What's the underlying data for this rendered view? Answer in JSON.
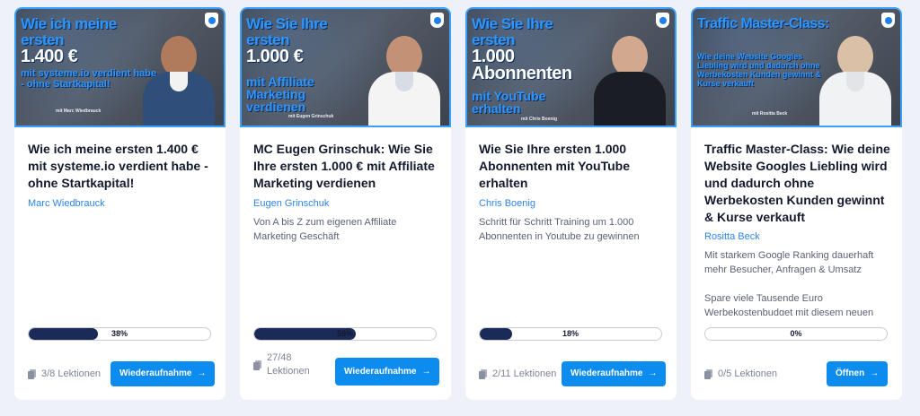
{
  "courses": [
    {
      "thumb_lines": [
        "Wie ich meine ersten",
        "1.400 €"
      ],
      "thumb_sub": "mit systeme.io verdient habe\n- ohne Startkapital!",
      "thumb_byline": "mit Marc Wiedbrauck",
      "title": "Wie ich meine ersten 1.400 € mit systeme.io verdient habe - ohne Startkapital!",
      "author": "Marc Wiedbrauck",
      "description": "",
      "progress_label": "38%",
      "progress": 0.38,
      "lessons": "3/8 Lektionen",
      "button": "Wiederaufnahme"
    },
    {
      "thumb_lines": [
        "Wie Sie Ihre",
        "ersten",
        "1.000 €"
      ],
      "thumb_sub": "mit Affiliate\nMarketing\nverdienen",
      "thumb_byline": "mit Eugen Grinschuk",
      "title": "MC Eugen Grinschuk: Wie Sie Ihre ersten 1.000 € mit Affiliate Marketing verdienen",
      "author": "Eugen Grinschuk",
      "description": "Von A bis Z zum eigenen Affiliate Marketing Geschäft",
      "progress_label": "56%",
      "progress": 0.56,
      "lessons": "27/48\nLektionen",
      "button": "Wiederaufnahme"
    },
    {
      "thumb_lines": [
        "Wie Sie Ihre",
        "ersten",
        "1.000",
        "Abonnenten"
      ],
      "thumb_sub": "mit YouTube\nerhalten",
      "thumb_byline": "mit Chris Boenig",
      "title": "Wie Sie Ihre ersten 1.000 Abonnenten mit YouTube erhalten",
      "author": "Chris Boenig",
      "description": "Schritt für Schritt Training um 1.000 Abonnenten in Youtube zu gewinnen",
      "progress_label": "18%",
      "progress": 0.18,
      "lessons": "2/11 Lektionen",
      "button": "Wiederaufnahme"
    },
    {
      "thumb_lines": [
        "Traffic Master-Class:"
      ],
      "thumb_sub": "Wie deine Website Googles\nLiebling wird und dadurch ohne\nWerbekosten Kunden gewinnt &\nKurse verkauft",
      "thumb_byline": "mit Rositta Beck",
      "title": "Traffic Master-Class: Wie deine Website Googles Liebling wird und dadurch ohne Werbekosten Kunden gewinnt & Kurse verkauft",
      "author": "Rositta Beck",
      "description": "Mit starkem Google Ranking dauerhaft mehr Besucher, Anfragen & Umsatz\n\nSpare viele Tausende Euro Werbekostenbudget mit diesem neuen",
      "progress_label": "0%",
      "progress": 0.0,
      "lessons": "0/5 Lektionen",
      "button": "Öffnen"
    }
  ],
  "colors": {
    "accent": "#0d8cf0",
    "progress_fill": "#1b2a56",
    "author_link": "#2f84e8",
    "background": "#eef1f7"
  },
  "icons": {
    "lessons": "lessons-document-icon",
    "button_arrow": "arrow-right-icon",
    "thumb_badge": "shield-badge-icon"
  }
}
